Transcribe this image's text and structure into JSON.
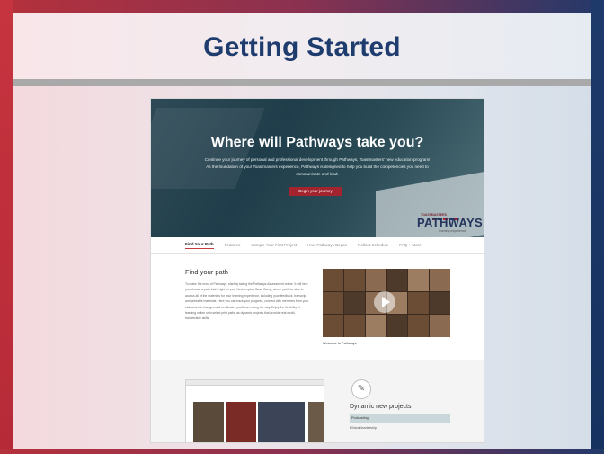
{
  "slide": {
    "title": "Getting Started"
  },
  "site": {
    "hero": {
      "heading": "Where will Pathways take you?",
      "subtext": "Continue your journey of personal and professional development through Pathways, Toastmasters' new education program! As the foundation of your Toastmasters experience, Pathways is designed to help you build the competencies you need to communicate and lead.",
      "button": "Begin your journey"
    },
    "logo": {
      "small": "TOASTMASTERS",
      "word": "PATHWAYS",
      "tag": "learning experience"
    },
    "nav": [
      "Find Your Path",
      "Features",
      "Sample Your First Project",
      "How Pathways Began",
      "Rollout Schedule",
      "FAQ + More"
    ],
    "find": {
      "title": "Find your path",
      "text": "To make the most of Pathways, start by taking the Pathways Assessment online. It will help you choose a path that's right for you. Next, explore Base Camp, where you'll be able to access all of the materials for your learning experience, including your feedback, transcript and printable materials. Here you can track your progress, connect with members from your club and earn badges and certificates you'll earn along the way. Enjoy the flexibility of learning online or in select print paths as dynamic projects that provide real-world, transferable skills."
    },
    "video_caption": "Welcome to Pathways",
    "dynamic": {
      "title": "Dynamic new projects",
      "item1": "Podcasting",
      "item2": "Ethical leadership"
    },
    "colors": {
      "accent_red": "#a3232f",
      "navy": "#24345c"
    }
  }
}
